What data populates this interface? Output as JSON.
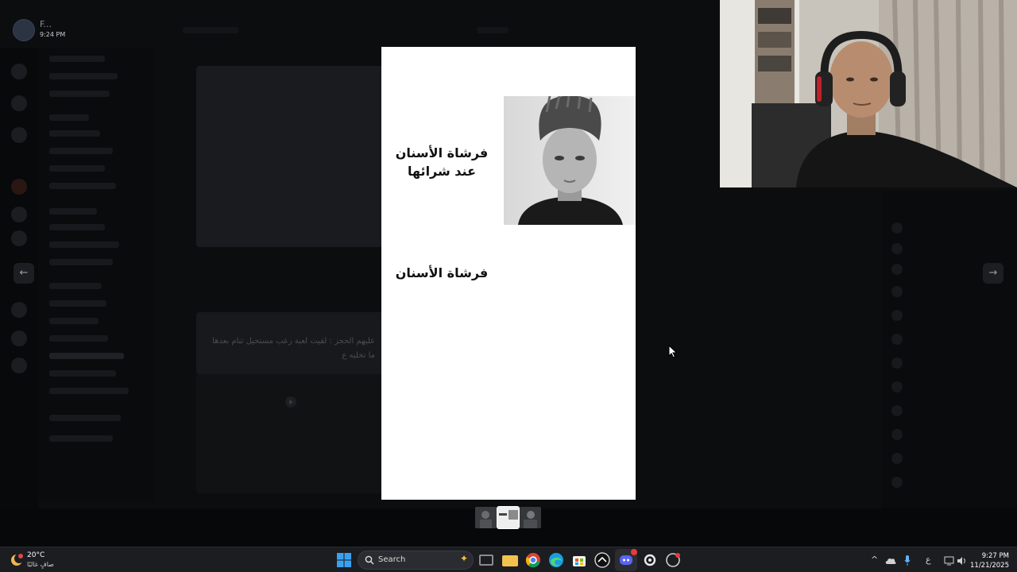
{
  "user": {
    "name": "F...",
    "time": "9:24 PM"
  },
  "chat": {
    "card_text": "عليهم الحجز : لقيت لعبة رعب مستحيل تنام بعدها ما تخليه ع"
  },
  "viewer": {
    "caption_top": "فرشاة الأسنان عند شرائها",
    "caption_bottom": "فرشاة الأسنان",
    "prev_arrow": "←",
    "next_arrow": "→"
  },
  "taskbar": {
    "weather_temp": "20°C",
    "weather_condition": "صافٍ غالبًا",
    "search_label": "Search",
    "language": "ع",
    "clock_time": "9:27 PM",
    "clock_date": "11/21/2025"
  },
  "icons": {
    "start": "windows-start-icon",
    "search": "search-icon",
    "task_view": "task-view-icon",
    "explorer": "file-explorer-icon",
    "chrome": "chrome-icon",
    "edge": "edge-icon",
    "store": "store-icon",
    "misc": "app-icon",
    "discord": "discord-icon",
    "steelseries": "steelseries-icon",
    "obs": "obs-icon"
  },
  "colors": {
    "viewer_bg": "#ffffff",
    "taskbar_bg": "#1c1d21",
    "discord_accent": "#5865f2"
  }
}
